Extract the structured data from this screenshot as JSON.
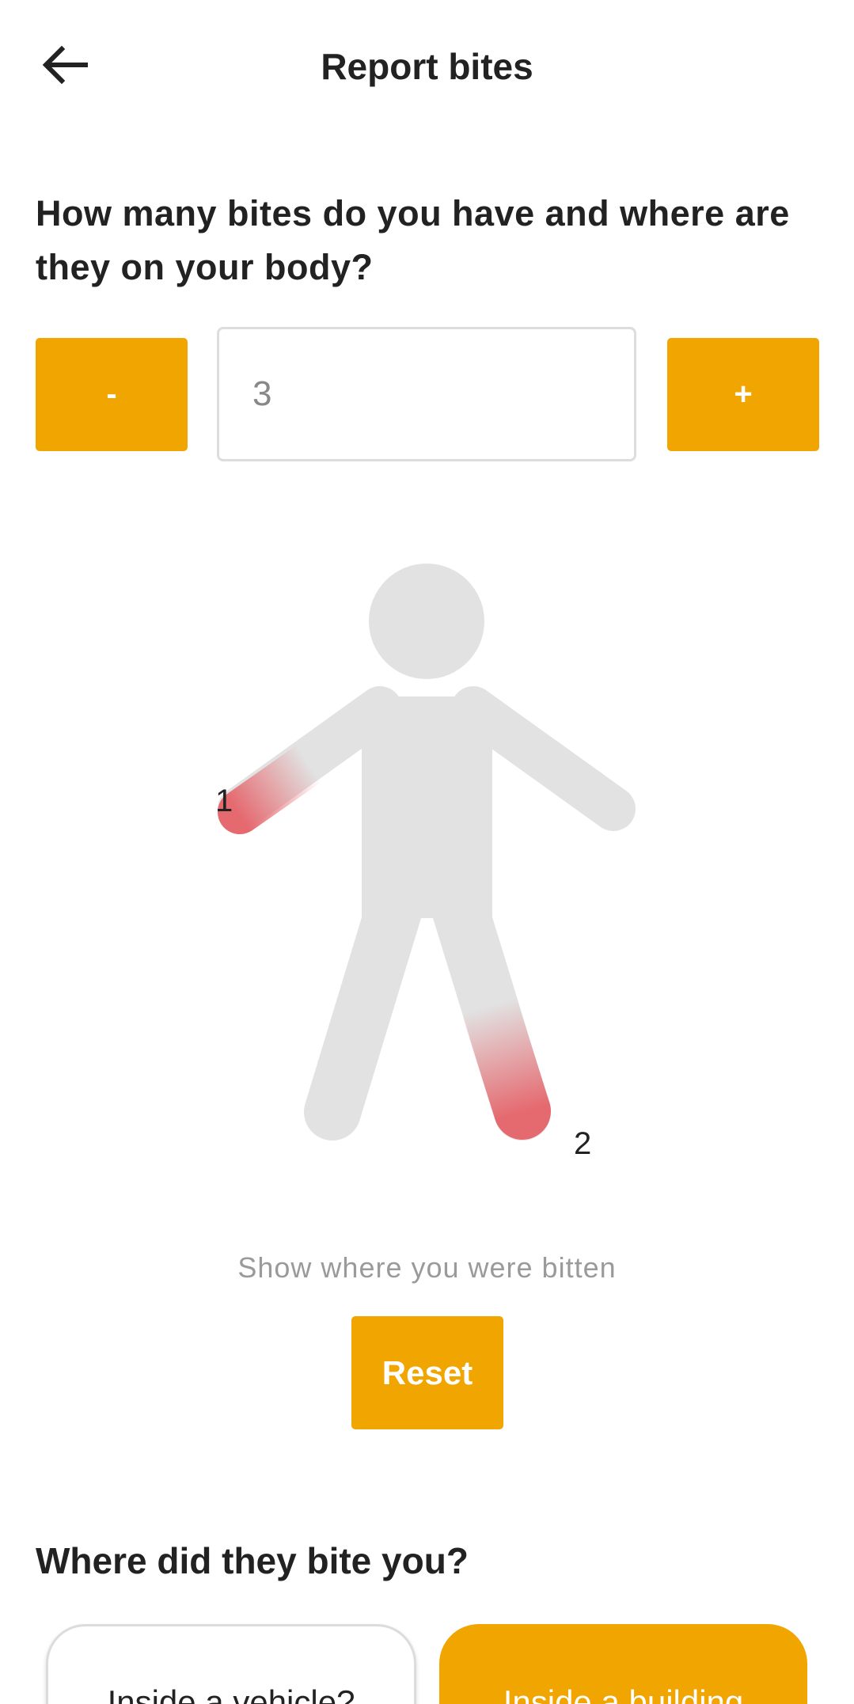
{
  "colors": {
    "accent": "#F0A500",
    "figure": "#E2E2E2",
    "bite_highlight": "#E56A70",
    "text_primary": "#222222",
    "text_muted": "#9A9A9A"
  },
  "header": {
    "title": "Report bites",
    "back_icon": "arrow-left-icon"
  },
  "bite_count_section": {
    "question": "How many bites do you have and where are they on your body?",
    "decrement_label": "-",
    "increment_label": "+",
    "count_value": "3"
  },
  "body_map": {
    "markers": [
      {
        "label": "1",
        "body_part": "left forearm"
      },
      {
        "label": "2",
        "body_part": "right lower leg"
      }
    ],
    "hint": "Show where you were bitten",
    "reset_label": "Reset"
  },
  "location_section": {
    "title": "Where did they bite you?",
    "options": [
      {
        "label": "Inside a vehicle?",
        "selected": false
      },
      {
        "label": "Inside a building",
        "selected": true
      }
    ]
  }
}
